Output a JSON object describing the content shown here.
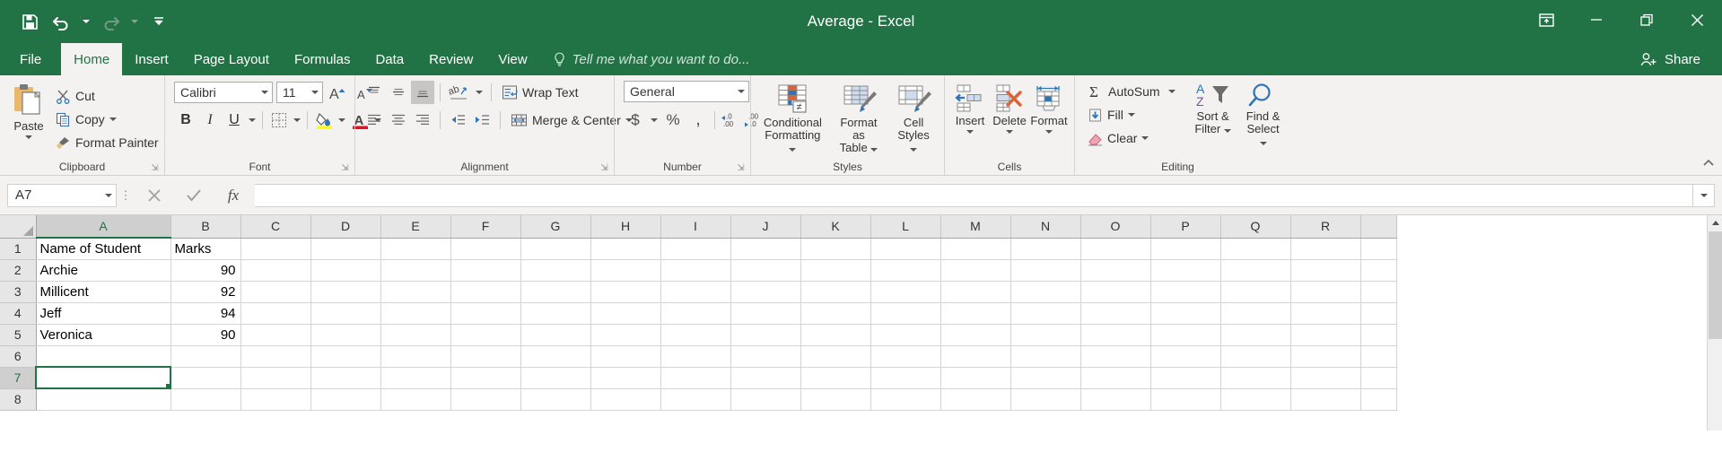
{
  "window": {
    "title": "Average - Excel",
    "quick_access": [
      "save-icon",
      "undo-icon",
      "redo-icon",
      "customize-qat-icon"
    ],
    "controls": [
      "ribbon-display-options-icon",
      "minimize-icon",
      "restore-icon",
      "close-icon"
    ]
  },
  "tabs": [
    {
      "label": "File",
      "active": false
    },
    {
      "label": "Home",
      "active": true
    },
    {
      "label": "Insert",
      "active": false
    },
    {
      "label": "Page Layout",
      "active": false
    },
    {
      "label": "Formulas",
      "active": false
    },
    {
      "label": "Data",
      "active": false
    },
    {
      "label": "Review",
      "active": false
    },
    {
      "label": "View",
      "active": false
    }
  ],
  "tell_me": "Tell me what you want to do...",
  "share": "Share",
  "ribbon": {
    "clipboard": {
      "label": "Clipboard",
      "paste": "Paste",
      "cut": "Cut",
      "copy": "Copy",
      "format_painter": "Format Painter"
    },
    "font": {
      "label": "Font",
      "font_name": "Calibri",
      "font_size": "11",
      "bold": "B",
      "italic": "I",
      "underline": "U"
    },
    "alignment": {
      "label": "Alignment",
      "wrap_text": "Wrap Text",
      "merge_center": "Merge & Center"
    },
    "number": {
      "label": "Number",
      "format": "General",
      "currency": "$",
      "percent": "%",
      "comma": ",",
      "increase_decimal": ".00",
      "decrease_decimal": ".00"
    },
    "styles": {
      "label": "Styles",
      "conditional_formatting_l1": "Conditional",
      "conditional_formatting_l2": "Formatting",
      "format_as_table_l1": "Format as",
      "format_as_table_l2": "Table",
      "cell_styles_l1": "Cell",
      "cell_styles_l2": "Styles"
    },
    "cells": {
      "label": "Cells",
      "insert": "Insert",
      "delete": "Delete",
      "format": "Format"
    },
    "editing": {
      "label": "Editing",
      "autosum": "AutoSum",
      "fill": "Fill",
      "clear": "Clear",
      "sort_filter_l1": "Sort &",
      "sort_filter_l2": "Filter",
      "find_select_l1": "Find &",
      "find_select_l2": "Select"
    }
  },
  "formula_bar": {
    "name_box": "A7",
    "formula": "",
    "cancel": "cancel-icon",
    "enter": "enter-icon",
    "insert_function": "fx"
  },
  "sheet": {
    "columns": [
      "A",
      "B",
      "C",
      "D",
      "E",
      "F",
      "G",
      "H",
      "I",
      "J",
      "K",
      "L",
      "M",
      "N",
      "O",
      "P",
      "Q",
      "R"
    ],
    "selected_column": "A",
    "selected_row": "7",
    "active_cell": "A7",
    "rows": [
      {
        "num": "1",
        "a": "Name of Student",
        "b": "Marks",
        "b_numeric": false
      },
      {
        "num": "2",
        "a": "Archie",
        "b": "90",
        "b_numeric": true
      },
      {
        "num": "3",
        "a": "Millicent",
        "b": "92",
        "b_numeric": true
      },
      {
        "num": "4",
        "a": "Jeff",
        "b": "94",
        "b_numeric": true
      },
      {
        "num": "5",
        "a": "Veronica",
        "b": "90",
        "b_numeric": true
      },
      {
        "num": "6",
        "a": "",
        "b": "",
        "b_numeric": false
      },
      {
        "num": "7",
        "a": "",
        "b": "",
        "b_numeric": false
      },
      {
        "num": "8",
        "a": "",
        "b": "",
        "b_numeric": false
      }
    ]
  },
  "colors": {
    "excel_green": "#217346",
    "ribbon_bg": "#f3f2f1",
    "grid_line": "#d4d4d4",
    "header_bg": "#e6e6e6"
  }
}
